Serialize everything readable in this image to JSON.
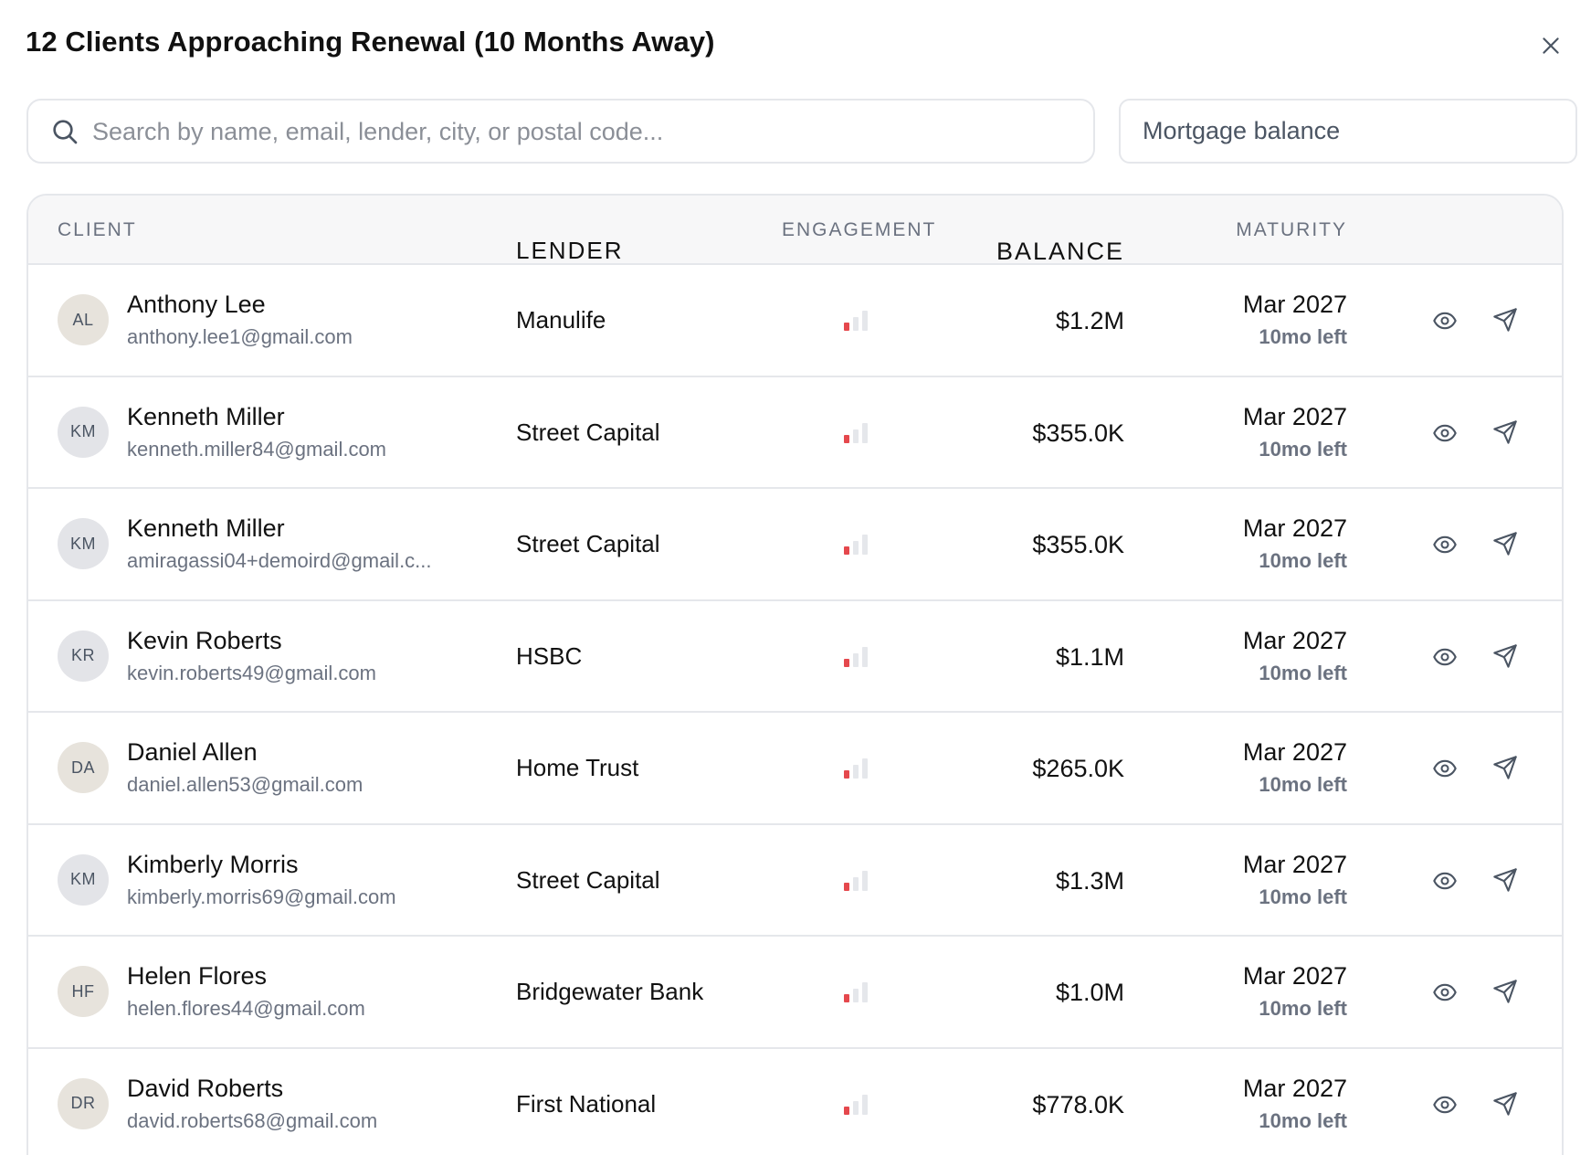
{
  "modal": {
    "title": "12 Clients Approaching Renewal (10 Months Away)",
    "close_icon": "close-icon"
  },
  "search": {
    "placeholder": "Search by name, email, lender, city, or postal code...",
    "value": "",
    "icon": "search-icon"
  },
  "sort": {
    "selected": "Mortgage balance"
  },
  "table": {
    "headers": {
      "client": "CLIENT",
      "lender": "LENDER",
      "engagement": "ENGAGEMENT",
      "balance": "BALANCE",
      "maturity": "MATURITY"
    },
    "rows": [
      {
        "initials": "AL",
        "name": "Anthony Lee",
        "email": "anthony.lee1@gmail.com",
        "lender": "Manulife",
        "engagement_level": 1,
        "balance": "$1.2M",
        "maturity": "Mar 2027",
        "left": "10mo left",
        "avatar_color": "#e7e3dc"
      },
      {
        "initials": "KM",
        "name": "Kenneth Miller",
        "email": "kenneth.miller84@gmail.com",
        "lender": "Street Capital",
        "engagement_level": 1,
        "balance": "$355.0K",
        "maturity": "Mar 2027",
        "left": "10mo left",
        "avatar_color": "#e3e4e8"
      },
      {
        "initials": "KM",
        "name": "Kenneth Miller",
        "email": "amiragassi04+demoird@gmail.c...",
        "lender": "Street Capital",
        "engagement_level": 1,
        "balance": "$355.0K",
        "maturity": "Mar 2027",
        "left": "10mo left",
        "avatar_color": "#e3e4e8"
      },
      {
        "initials": "KR",
        "name": "Kevin Roberts",
        "email": "kevin.roberts49@gmail.com",
        "lender": "HSBC",
        "engagement_level": 1,
        "balance": "$1.1M",
        "maturity": "Mar 2027",
        "left": "10mo left",
        "avatar_color": "#e3e4e8"
      },
      {
        "initials": "DA",
        "name": "Daniel Allen",
        "email": "daniel.allen53@gmail.com",
        "lender": "Home Trust",
        "engagement_level": 1,
        "balance": "$265.0K",
        "maturity": "Mar 2027",
        "left": "10mo left",
        "avatar_color": "#e7e3dc"
      },
      {
        "initials": "KM",
        "name": "Kimberly Morris",
        "email": "kimberly.morris69@gmail.com",
        "lender": "Street Capital",
        "engagement_level": 1,
        "balance": "$1.3M",
        "maturity": "Mar 2027",
        "left": "10mo left",
        "avatar_color": "#e3e4e8"
      },
      {
        "initials": "HF",
        "name": "Helen Flores",
        "email": "helen.flores44@gmail.com",
        "lender": "Bridgewater Bank",
        "engagement_level": 1,
        "balance": "$1.0M",
        "maturity": "Mar 2027",
        "left": "10mo left",
        "avatar_color": "#e7e3dc"
      },
      {
        "initials": "DR",
        "name": "David Roberts",
        "email": "david.roberts68@gmail.com",
        "lender": "First National",
        "engagement_level": 1,
        "balance": "$778.0K",
        "maturity": "Mar 2027",
        "left": "10mo left",
        "avatar_color": "#e7e3dc"
      }
    ],
    "row_icons": {
      "view": "eye-icon",
      "send": "send-icon"
    }
  },
  "colors": {
    "engagement_active": "#e5484d",
    "engagement_inactive": "#e5e7eb"
  }
}
